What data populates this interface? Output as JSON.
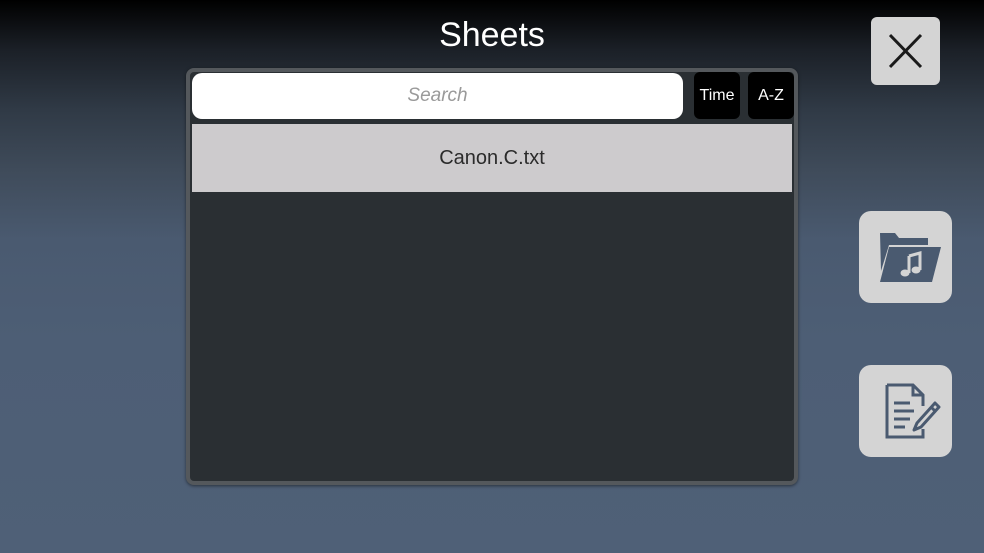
{
  "header": {
    "title": "Sheets"
  },
  "search": {
    "placeholder": "Search",
    "value": ""
  },
  "sort": {
    "time_label": "Time",
    "az_label": "A-Z"
  },
  "files": [
    {
      "name": "Canon.C.txt"
    }
  ],
  "icons": {
    "close": "close-icon",
    "folder": "music-folder-icon",
    "edit": "edit-document-icon"
  },
  "colors": {
    "panel": "#2a2f33",
    "list_item": "#cdcbcd",
    "button_bg": "#d4d4d4",
    "icon": "#4a5a70"
  }
}
